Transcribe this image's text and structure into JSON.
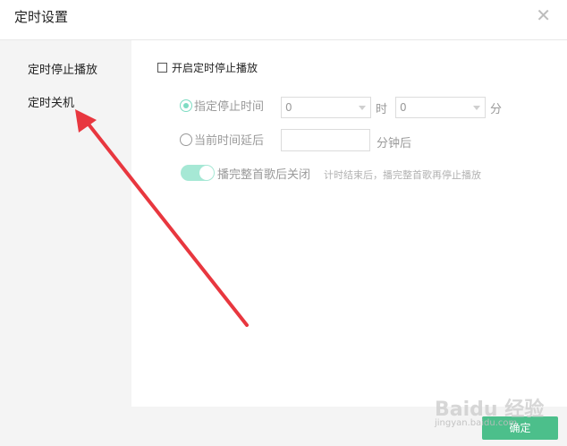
{
  "window": {
    "title": "定时设置"
  },
  "sidebar": {
    "items": [
      {
        "label": "定时停止播放"
      },
      {
        "label": "定时关机"
      }
    ]
  },
  "main": {
    "enable_checkbox": {
      "label": "开启定时停止播放",
      "checked": false
    },
    "option_specific_time": {
      "label": "指定停止时间",
      "selected": true,
      "hour_value": "0",
      "hour_unit": "时",
      "minute_value": "0",
      "minute_unit": "分"
    },
    "option_delay": {
      "label": "当前时间延后",
      "selected": false,
      "input_value": "",
      "unit": "分钟后"
    },
    "finish_song_toggle": {
      "label": "播完整首歌后关闭",
      "on": true,
      "hint": "计时结束后，播完整首歌再停止播放"
    }
  },
  "footer": {
    "ok_label": "确定"
  },
  "watermark": {
    "text": "Baidu 经验",
    "sub": "jingyan.baidu.com"
  },
  "colors": {
    "accent": "#4cbf8b",
    "toggle": "#a6e8d5",
    "arrow": "#e8373f"
  }
}
